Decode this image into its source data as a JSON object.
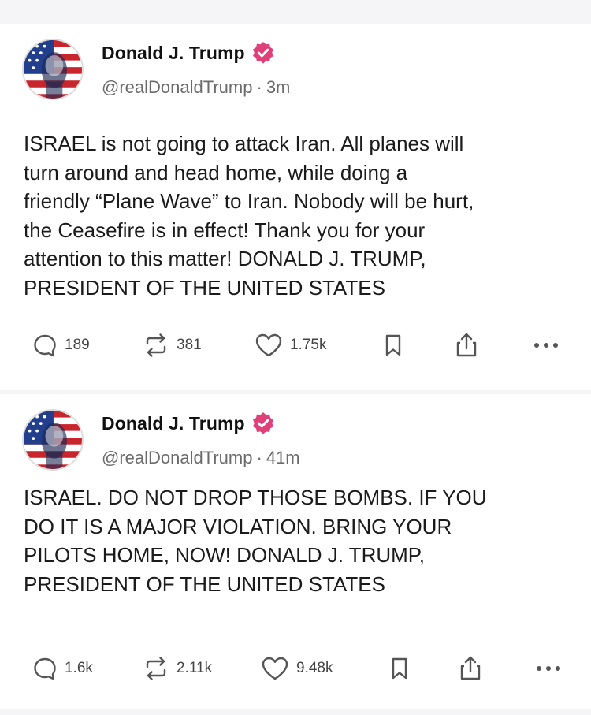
{
  "colors": {
    "verified_badge": "#e0407a",
    "background": "#f5f5f7",
    "card": "#ffffff",
    "muted_text": "#6b6b6b"
  },
  "posts": [
    {
      "author": "Donald J. Trump",
      "handle": "@realDonaldTrump",
      "separator": "·",
      "time": "3m",
      "verified_icon": "verified-badge-icon",
      "avatar_icon": "avatar-flag-portrait",
      "text": "ISRAEL is not going to attack Iran. All planes will\nturn around and head home, while doing a\nfriendly “Plane Wave” to Iran. Nobody will be hurt,\nthe Ceasefire is in effect! Thank you for your\nattention to this matter! DONALD J. TRUMP,\nPRESIDENT OF THE UNITED STATES",
      "replies": "189",
      "retruths": "381",
      "likes": "1.75k"
    },
    {
      "author": "Donald J. Trump",
      "handle": "@realDonaldTrump",
      "separator": "·",
      "time": "41m",
      "verified_icon": "verified-badge-icon",
      "avatar_icon": "avatar-flag-portrait",
      "text": "ISRAEL. DO NOT DROP THOSE BOMBS. IF YOU\nDO IT IS A MAJOR VIOLATION. BRING YOUR\nPILOTS HOME, NOW!  DONALD J. TRUMP,\nPRESIDENT OF THE UNITED STATES",
      "replies": "1.6k",
      "retruths": "2.11k",
      "likes": "9.48k"
    }
  ]
}
